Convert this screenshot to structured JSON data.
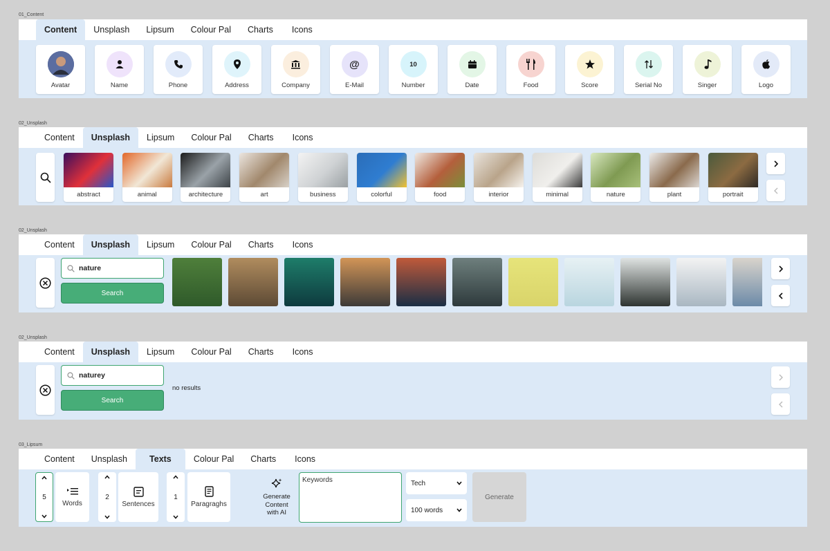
{
  "frames": [
    {
      "label": "01_Content"
    },
    {
      "label": "02_Unsplash"
    },
    {
      "label": "02_Unsplash"
    },
    {
      "label": "02_Unsplash"
    },
    {
      "label": "03_Lipsum"
    }
  ],
  "tabs_a": [
    "Content",
    "Unsplash",
    "Lipsum",
    "Colour Pal",
    "Charts",
    "Icons"
  ],
  "tabs_b": [
    "Content",
    "Unsplash",
    "Texts",
    "Colour Pal",
    "Charts",
    "Icons"
  ],
  "content_items": [
    {
      "label": "Avatar",
      "icon": "avatar-photo",
      "bg": "#dbe3f3"
    },
    {
      "label": "Name",
      "icon": "person-icon",
      "bg": "#efe3fb"
    },
    {
      "label": "Phone",
      "icon": "phone-icon",
      "bg": "#e2ebfa"
    },
    {
      "label": "Address",
      "icon": "location-pin-icon",
      "bg": "#dff4fb"
    },
    {
      "label": "Company",
      "icon": "bank-icon",
      "bg": "#fbeede"
    },
    {
      "label": "E-Mail",
      "icon": "at-sign-icon",
      "bg": "#e6e3fa"
    },
    {
      "label": "Number",
      "icon": "number-icon",
      "bg": "#d7f4fb",
      "glyph": "10"
    },
    {
      "label": "Date",
      "icon": "calendar-icon",
      "bg": "#e3f6e6"
    },
    {
      "label": "Food",
      "icon": "fork-knife-icon",
      "bg": "#f7d4d0"
    },
    {
      "label": "Score",
      "icon": "star-icon",
      "bg": "#fcf3d3"
    },
    {
      "label": "Serial No",
      "icon": "sort-arrows-icon",
      "bg": "#dbf5ef"
    },
    {
      "label": "Singer",
      "icon": "music-note-icon",
      "bg": "#eef3d8"
    },
    {
      "label": "Logo",
      "icon": "apple-logo-icon",
      "bg": "#e3eaf8"
    }
  ],
  "unsplash_categories": [
    {
      "label": "abstract",
      "colors": [
        "#3a0f5e",
        "#e0303a",
        "#2757c9"
      ]
    },
    {
      "label": "animal",
      "colors": [
        "#e2682a",
        "#f1e7d6",
        "#c97a3f"
      ]
    },
    {
      "label": "architecture",
      "colors": [
        "#1c1c1c",
        "#9aa2a8",
        "#3e4448"
      ]
    },
    {
      "label": "art",
      "colors": [
        "#ebe5df",
        "#a1886c",
        "#d8d1c8"
      ]
    },
    {
      "label": "business",
      "colors": [
        "#f3f3f3",
        "#cfd2d4",
        "#9aa0a3"
      ]
    },
    {
      "label": "colorful",
      "colors": [
        "#2a6db8",
        "#2f7dd1",
        "#f2c230"
      ]
    },
    {
      "label": "food",
      "colors": [
        "#efe9e2",
        "#b45f3c",
        "#7a8f3a"
      ]
    },
    {
      "label": "interior",
      "colors": [
        "#e9e4dd",
        "#b9a48a",
        "#f6f3ee"
      ]
    },
    {
      "label": "minimal",
      "colors": [
        "#dddcd8",
        "#f0efec",
        "#3a3a3a"
      ]
    },
    {
      "label": "nature",
      "colors": [
        "#d8e8c0",
        "#7f9a52",
        "#a8c07a"
      ]
    },
    {
      "label": "plant",
      "colors": [
        "#ecebea",
        "#8a6a4c",
        "#dcd7d2"
      ]
    },
    {
      "label": "portrait",
      "colors": [
        "#4a5a3c",
        "#8c6b42",
        "#2f2a25"
      ]
    }
  ],
  "search": {
    "query_1": "nature",
    "query_2": "naturey",
    "button": "Search",
    "no_results": "no results"
  },
  "nature_photos": [
    [
      "#2f5a2a",
      "#4f7f3b"
    ],
    [
      "#5d4a35",
      "#b08c5e"
    ],
    [
      "#0e3a3e",
      "#1e7d6a"
    ],
    [
      "#3d3a38",
      "#d29557"
    ],
    [
      "#1a2e45",
      "#c05a3a"
    ],
    [
      "#2e3a3c",
      "#6e7f7d"
    ],
    [
      "#d9d46a",
      "#e6e47a"
    ],
    [
      "#b9d5df",
      "#e7f1f4"
    ],
    [
      "#2f3532",
      "#dfe3e2"
    ],
    [
      "#a9b7c2",
      "#f3f3f3"
    ],
    [
      "#6c8aa8",
      "#d9d4cc"
    ]
  ],
  "lipsum": {
    "words_count": "5",
    "words_label": "Words",
    "sentences_count": "2",
    "sentences_label": "Sentences",
    "paragraphs_count": "1",
    "paragraphs_label": "Paragraghs",
    "ai_label_1": "Generate",
    "ai_label_2": "Content",
    "ai_label_3": "with AI",
    "keywords_placeholder": "Keywords",
    "topic_select": "Tech",
    "length_select": "100 words",
    "generate_button": "Generate"
  },
  "colors": {
    "accent_green": "#47ad78",
    "panel_bg": "#dce9f7"
  }
}
